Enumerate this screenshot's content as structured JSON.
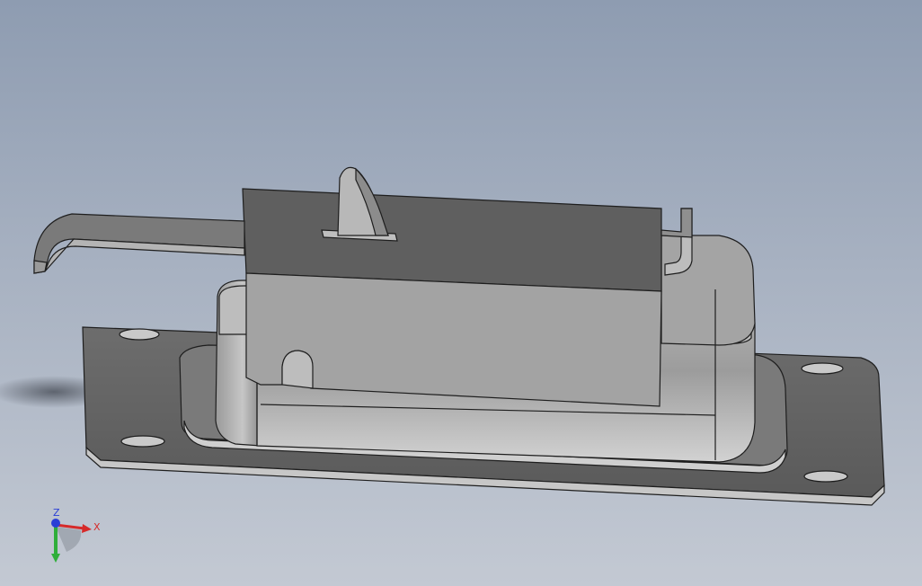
{
  "viewport": {
    "background_top": "#8e9cb1",
    "background_bottom": "#c3c9d3"
  },
  "model": {
    "name": "",
    "edge_color": "#1e1e1e",
    "shade_dark": "#5f5f5f",
    "shade_mid": "#9a9a9a",
    "shade_light": "#c8c8c8"
  },
  "triad": {
    "x_label": "X",
    "z_label": "Z",
    "x_color": "#d62a2a",
    "y_color": "#2fae3a",
    "z_color": "#2a3fd6"
  }
}
